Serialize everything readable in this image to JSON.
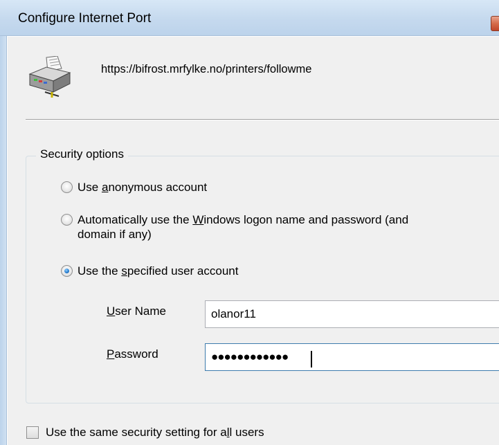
{
  "window": {
    "title": "Configure Internet Port"
  },
  "header": {
    "icon": "printer-icon",
    "url": "https://bifrost.mrfylke.no/printers/followme"
  },
  "security": {
    "group_label": "Security options",
    "options": [
      {
        "pre": "Use ",
        "accel": "a",
        "post": "nonymous account",
        "checked": false
      },
      {
        "pre": "Automatically use the ",
        "accel": "W",
        "post": "indows logon name and password (and",
        "line2": "domain if any)",
        "checked": false
      },
      {
        "pre": "Use the ",
        "accel": "s",
        "post": "pecified user account",
        "checked": true
      }
    ],
    "username": {
      "label_accel": "U",
      "label_rest": "ser Name",
      "value": "olanor11"
    },
    "password": {
      "label_accel": "P",
      "label_rest": "assword",
      "value": "●●●●●●●●●●●●"
    }
  },
  "footer": {
    "checkbox": {
      "pre": "Use the same security setting for a",
      "accel": "l",
      "post": "l users",
      "checked": false
    }
  },
  "colors": {
    "titlebar": "#c5d9ee",
    "dialog_bg": "#f0f0f0",
    "radio_selected": "#2c7fd0"
  }
}
